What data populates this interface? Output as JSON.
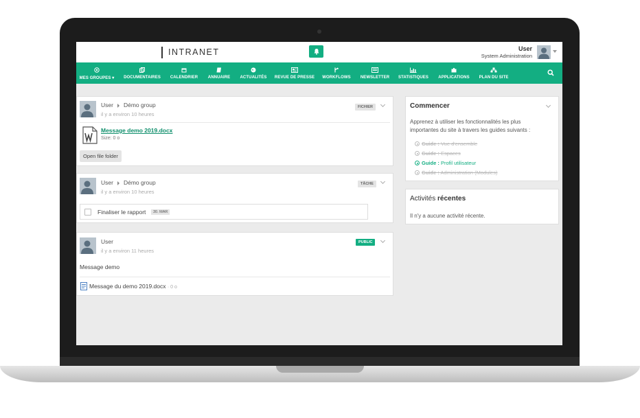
{
  "header": {
    "brand": "INTRANET",
    "user_name": "User",
    "user_role": "System Administration"
  },
  "nav": {
    "items": [
      {
        "label": "MES GROUPES",
        "icon": "target-icon"
      },
      {
        "label": "DOCUMENTAIRES",
        "icon": "copy-icon"
      },
      {
        "label": "CALENDRIER",
        "icon": "calendar-icon"
      },
      {
        "label": "ANNUAIRE",
        "icon": "book-icon"
      },
      {
        "label": "ACTUALITÉS",
        "icon": "globe-icon"
      },
      {
        "label": "REVUE DE PRESSE",
        "icon": "newspaper-icon"
      },
      {
        "label": "WORKFLOWS",
        "icon": "fork-icon"
      },
      {
        "label": "NEWSLETTER",
        "icon": "envelope-icon"
      },
      {
        "label": "STATISTIQUES",
        "icon": "bar-chart-icon"
      },
      {
        "label": "APPLICATIONS",
        "icon": "puzzle-icon"
      },
      {
        "label": "PLAN DU SITE",
        "icon": "sitemap-icon"
      }
    ]
  },
  "feed": {
    "posts": [
      {
        "author": "User",
        "group": "Démo group",
        "time": "il y a environ 10 heures",
        "badge": "FICHIER",
        "file_name": "Message demo 2019.docx",
        "file_size": "Size: 0 o",
        "button": "Open file folder"
      },
      {
        "author": "User",
        "group": "Démo group",
        "time": "il y a environ 10 heures",
        "badge": "TÂCHE",
        "task_label": "Finaliser le rapport",
        "task_date": "30. MAR"
      },
      {
        "author": "User",
        "time": "il y a environ 11 heures",
        "badge": "PUBLIC",
        "message": "Message demo",
        "attachment_name": "Message du demo 2019.docx",
        "attachment_size": "· 0 o"
      }
    ]
  },
  "sidebar": {
    "start": {
      "title": "Commencer",
      "text": "Apprenez à utiliser les fonctionnalités les plus importantes du site à travers les guides suivants :",
      "guides": [
        {
          "prefix": "Guide :",
          "label": "Vue d'ensemble",
          "done": true
        },
        {
          "prefix": "Guide :",
          "label": "Espaces",
          "done": true
        },
        {
          "prefix": "Guide :",
          "label": "Profil utilisateur",
          "done": false
        },
        {
          "prefix": "Guide :",
          "label": "Administration (Modules)",
          "done": true
        }
      ]
    },
    "recent": {
      "title_light": "Activités",
      "title_bold": "récentes",
      "empty_text": "Il n'y a aucune activité récente."
    }
  },
  "colors": {
    "accent": "#13ae82",
    "background": "#ebebeb"
  }
}
